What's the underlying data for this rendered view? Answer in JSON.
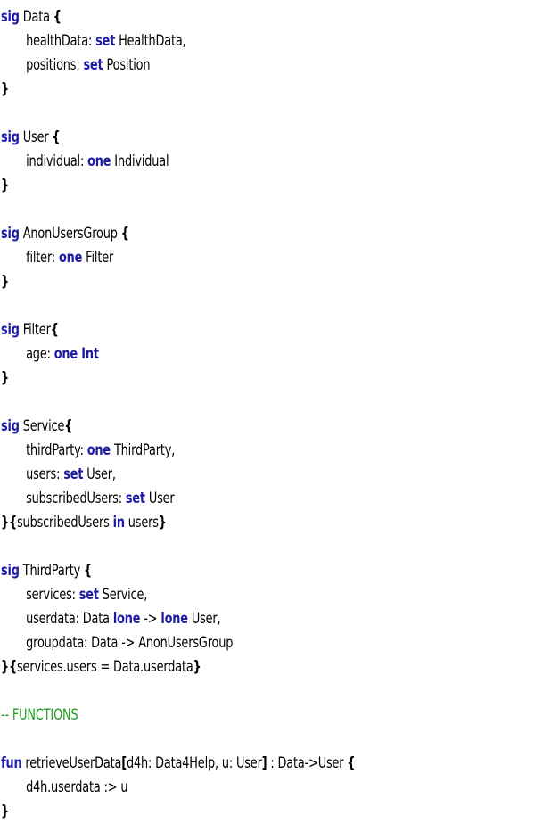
{
  "lines": [
    {
      "indent": false,
      "tokens": [
        {
          "t": "sig",
          "k": "kw"
        },
        {
          "t": " Data "
        },
        {
          "t": "{",
          "k": "br"
        }
      ]
    },
    {
      "indent": true,
      "tokens": [
        {
          "t": "healthData: "
        },
        {
          "t": "set",
          "k": "kw"
        },
        {
          "t": " HealthData,"
        }
      ]
    },
    {
      "indent": true,
      "tokens": [
        {
          "t": "positions: "
        },
        {
          "t": "set",
          "k": "kw"
        },
        {
          "t": " Position"
        }
      ]
    },
    {
      "indent": false,
      "tokens": [
        {
          "t": "}",
          "k": "br"
        }
      ]
    },
    {
      "indent": false,
      "tokens": []
    },
    {
      "indent": false,
      "tokens": [
        {
          "t": "sig",
          "k": "kw"
        },
        {
          "t": " User "
        },
        {
          "t": "{",
          "k": "br"
        }
      ]
    },
    {
      "indent": true,
      "tokens": [
        {
          "t": "individual: "
        },
        {
          "t": "one",
          "k": "kw"
        },
        {
          "t": " Individual"
        }
      ]
    },
    {
      "indent": false,
      "tokens": [
        {
          "t": "}",
          "k": "br"
        }
      ]
    },
    {
      "indent": false,
      "tokens": []
    },
    {
      "indent": false,
      "tokens": [
        {
          "t": "sig",
          "k": "kw"
        },
        {
          "t": " AnonUsersGroup "
        },
        {
          "t": "{",
          "k": "br"
        }
      ]
    },
    {
      "indent": true,
      "tokens": [
        {
          "t": "filter: "
        },
        {
          "t": "one",
          "k": "kw"
        },
        {
          "t": " Filter"
        }
      ]
    },
    {
      "indent": false,
      "tokens": [
        {
          "t": "}",
          "k": "br"
        }
      ]
    },
    {
      "indent": false,
      "tokens": []
    },
    {
      "indent": false,
      "tokens": [
        {
          "t": "sig",
          "k": "kw"
        },
        {
          "t": " Filter"
        },
        {
          "t": "{",
          "k": "br"
        }
      ]
    },
    {
      "indent": true,
      "tokens": [
        {
          "t": "age: "
        },
        {
          "t": "one Int",
          "k": "kw"
        }
      ]
    },
    {
      "indent": false,
      "tokens": [
        {
          "t": "}",
          "k": "br"
        }
      ]
    },
    {
      "indent": false,
      "tokens": []
    },
    {
      "indent": false,
      "tokens": [
        {
          "t": "sig",
          "k": "kw"
        },
        {
          "t": " Service"
        },
        {
          "t": "{",
          "k": "br"
        }
      ]
    },
    {
      "indent": true,
      "tokens": [
        {
          "t": "thirdParty: "
        },
        {
          "t": "one",
          "k": "kw"
        },
        {
          "t": " ThirdParty,"
        }
      ]
    },
    {
      "indent": true,
      "tokens": [
        {
          "t": "users: "
        },
        {
          "t": "set",
          "k": "kw"
        },
        {
          "t": " User,"
        }
      ]
    },
    {
      "indent": true,
      "tokens": [
        {
          "t": "subscribedUsers: "
        },
        {
          "t": "set",
          "k": "kw"
        },
        {
          "t": " User"
        }
      ]
    },
    {
      "indent": false,
      "tokens": [
        {
          "t": "}{",
          "k": "br"
        },
        {
          "t": "subscribedUsers "
        },
        {
          "t": "in",
          "k": "kw"
        },
        {
          "t": " users"
        },
        {
          "t": "}",
          "k": "br"
        }
      ]
    },
    {
      "indent": false,
      "tokens": []
    },
    {
      "indent": false,
      "tokens": [
        {
          "t": "sig",
          "k": "kw"
        },
        {
          "t": " ThirdParty "
        },
        {
          "t": "{",
          "k": "br"
        }
      ]
    },
    {
      "indent": true,
      "tokens": [
        {
          "t": "services: "
        },
        {
          "t": "set",
          "k": "kw"
        },
        {
          "t": " Service,"
        }
      ]
    },
    {
      "indent": true,
      "tokens": [
        {
          "t": "userdata: Data "
        },
        {
          "t": "lone",
          "k": "kw"
        },
        {
          "t": " -> "
        },
        {
          "t": "lone",
          "k": "kw"
        },
        {
          "t": " User,"
        }
      ]
    },
    {
      "indent": true,
      "tokens": [
        {
          "t": "groupdata: Data -> AnonUsersGroup"
        }
      ]
    },
    {
      "indent": false,
      "tokens": [
        {
          "t": "}{",
          "k": "br"
        },
        {
          "t": "services.users = Data.userdata"
        },
        {
          "t": "}",
          "k": "br"
        }
      ]
    },
    {
      "indent": false,
      "tokens": []
    },
    {
      "indent": false,
      "tokens": [
        {
          "t": "-- FUNCTIONS",
          "k": "cm"
        }
      ]
    },
    {
      "indent": false,
      "tokens": []
    },
    {
      "indent": false,
      "tokens": [
        {
          "t": "fun",
          "k": "kw"
        },
        {
          "t": " retrieveUserData"
        },
        {
          "t": "[",
          "k": "br"
        },
        {
          "t": "d4h: Data4Help, u: User"
        },
        {
          "t": "]",
          "k": "br"
        },
        {
          "t": " : Data->User "
        },
        {
          "t": "{",
          "k": "br"
        }
      ]
    },
    {
      "indent": true,
      "tokens": [
        {
          "t": "d4h.userdata :> u"
        }
      ]
    },
    {
      "indent": false,
      "tokens": [
        {
          "t": "}",
          "k": "br"
        }
      ]
    }
  ]
}
